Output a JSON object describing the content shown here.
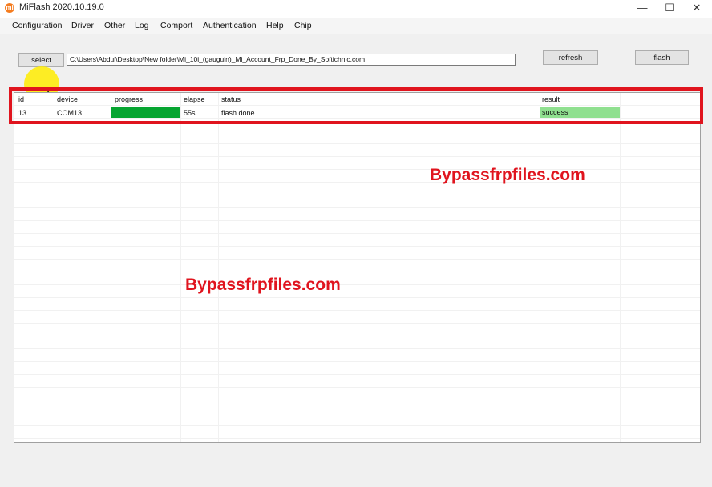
{
  "window": {
    "title": "MiFlash 2020.10.19.0",
    "app_icon_glyph": "mi",
    "controls": {
      "minimize": "—",
      "maximize": "☐",
      "close": "✕"
    }
  },
  "menu": {
    "items": [
      "Configuration",
      "Driver",
      "Other",
      "Log",
      "Comport",
      "Authentication",
      "Help",
      "Chip"
    ]
  },
  "toolbar": {
    "select_label": "select",
    "path_value": "C:\\Users\\Abdul\\Desktop\\New folder\\Mi_10i_(gauguin)_Mi_Account_Frp_Done_By_Softichnic.com",
    "refresh_label": "refresh",
    "flash_label": "flash"
  },
  "table": {
    "columns": {
      "id": "id",
      "device": "device",
      "progress": "progress",
      "elapse": "elapse",
      "status": "status",
      "result": "result"
    },
    "rows": [
      {
        "id": "13",
        "device": "COM13",
        "progress_fraction": 1.0,
        "elapse": "55s",
        "status": "flash done",
        "result": "success"
      }
    ]
  },
  "watermarks": [
    "Bypassfrpfiles.com",
    "Bypassfrpfiles.com"
  ],
  "colors": {
    "progress_fill": "#06a531",
    "result_success": "#90e090",
    "highlight_frame": "#e0141e",
    "watermark": "#e0141e",
    "cursor_highlight": "#ffec00"
  }
}
